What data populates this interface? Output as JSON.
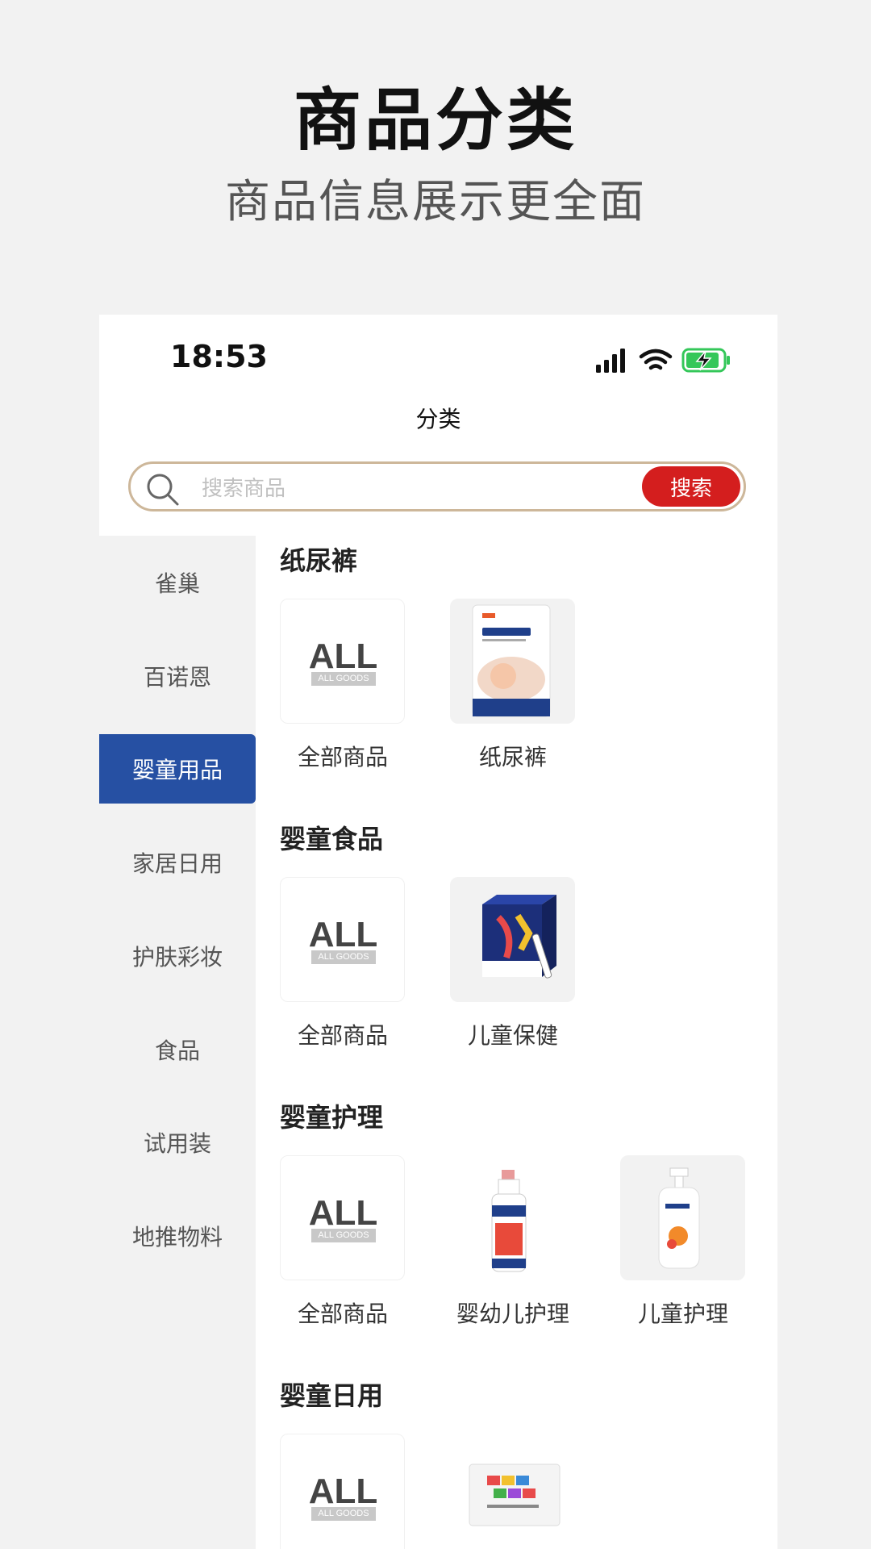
{
  "promo": {
    "title": "商品分类",
    "subtitle": "商品信息展示更全面"
  },
  "status_bar": {
    "time": "18:53"
  },
  "nav": {
    "title": "分类"
  },
  "search": {
    "placeholder": "搜索商品",
    "button_label": "搜索"
  },
  "colors": {
    "accent_blue": "#2650a3",
    "search_red": "#d41e1e",
    "search_border": "#cdb79a",
    "battery_green": "#34c759"
  },
  "sidebar": {
    "active_index": 2,
    "items": [
      {
        "label": "雀巢"
      },
      {
        "label": "百诺恩"
      },
      {
        "label": "婴童用品"
      },
      {
        "label": "家居日用"
      },
      {
        "label": "护肤彩妆"
      },
      {
        "label": "食品"
      },
      {
        "label": "试用装"
      },
      {
        "label": "地推物料"
      }
    ]
  },
  "all_badge": {
    "text": "ALL",
    "sub": "ALL GOODS"
  },
  "sections": [
    {
      "title": "纸尿裤",
      "items": [
        {
          "label": "全部商品",
          "icon": "all-goods"
        },
        {
          "label": "纸尿裤",
          "icon": "diaper-pack"
        }
      ]
    },
    {
      "title": "婴童食品",
      "items": [
        {
          "label": "全部商品",
          "icon": "all-goods"
        },
        {
          "label": "儿童保健",
          "icon": "supplement-box"
        }
      ]
    },
    {
      "title": "婴童护理",
      "items": [
        {
          "label": "全部商品",
          "icon": "all-goods"
        },
        {
          "label": "婴幼儿护理",
          "icon": "foam-bottle"
        },
        {
          "label": "儿童护理",
          "icon": "pump-bottle"
        }
      ]
    },
    {
      "title": "婴童日用",
      "items": [
        {
          "label": "全部商品",
          "icon": "all-goods"
        },
        {
          "label": "",
          "icon": "pants-box"
        }
      ]
    }
  ]
}
